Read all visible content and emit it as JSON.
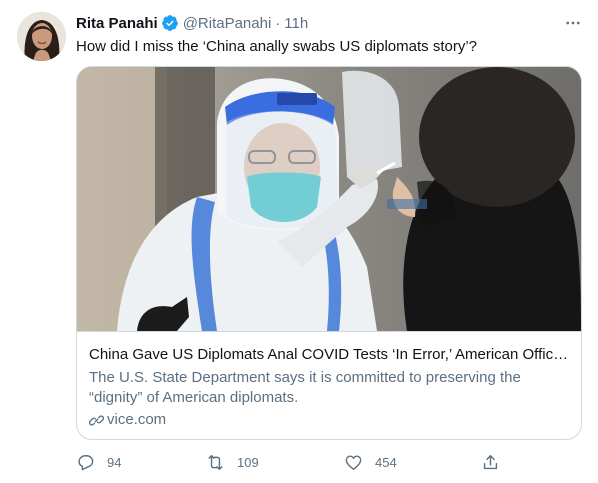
{
  "tweet": {
    "author_name": "Rita Panahi",
    "handle": "@RitaPanahi",
    "separator": "·",
    "time": "11h",
    "text": "How did I miss the ‘China anally swabs US diplomats story’?",
    "verified": true
  },
  "card": {
    "title": "China Gave US Diplomats Anal COVID Tests ‘In Error,’ American Official…",
    "description": "The U.S. State Department says it is committed to preserving the “dignity” of American diplomats.",
    "domain": "vice.com",
    "image_label": "A health worker in protective gear takes a swab sample"
  },
  "actions": {
    "reply_count": "94",
    "retweet_count": "109",
    "like_count": "454"
  },
  "colors": {
    "text": "#0f1419",
    "secondary": "#5b7083",
    "border": "#cfd9de",
    "verified": "#1da1f2"
  },
  "icons": [
    "verified-badge-icon",
    "more-icon",
    "link-icon",
    "reply-icon",
    "retweet-icon",
    "like-icon",
    "share-icon"
  ]
}
